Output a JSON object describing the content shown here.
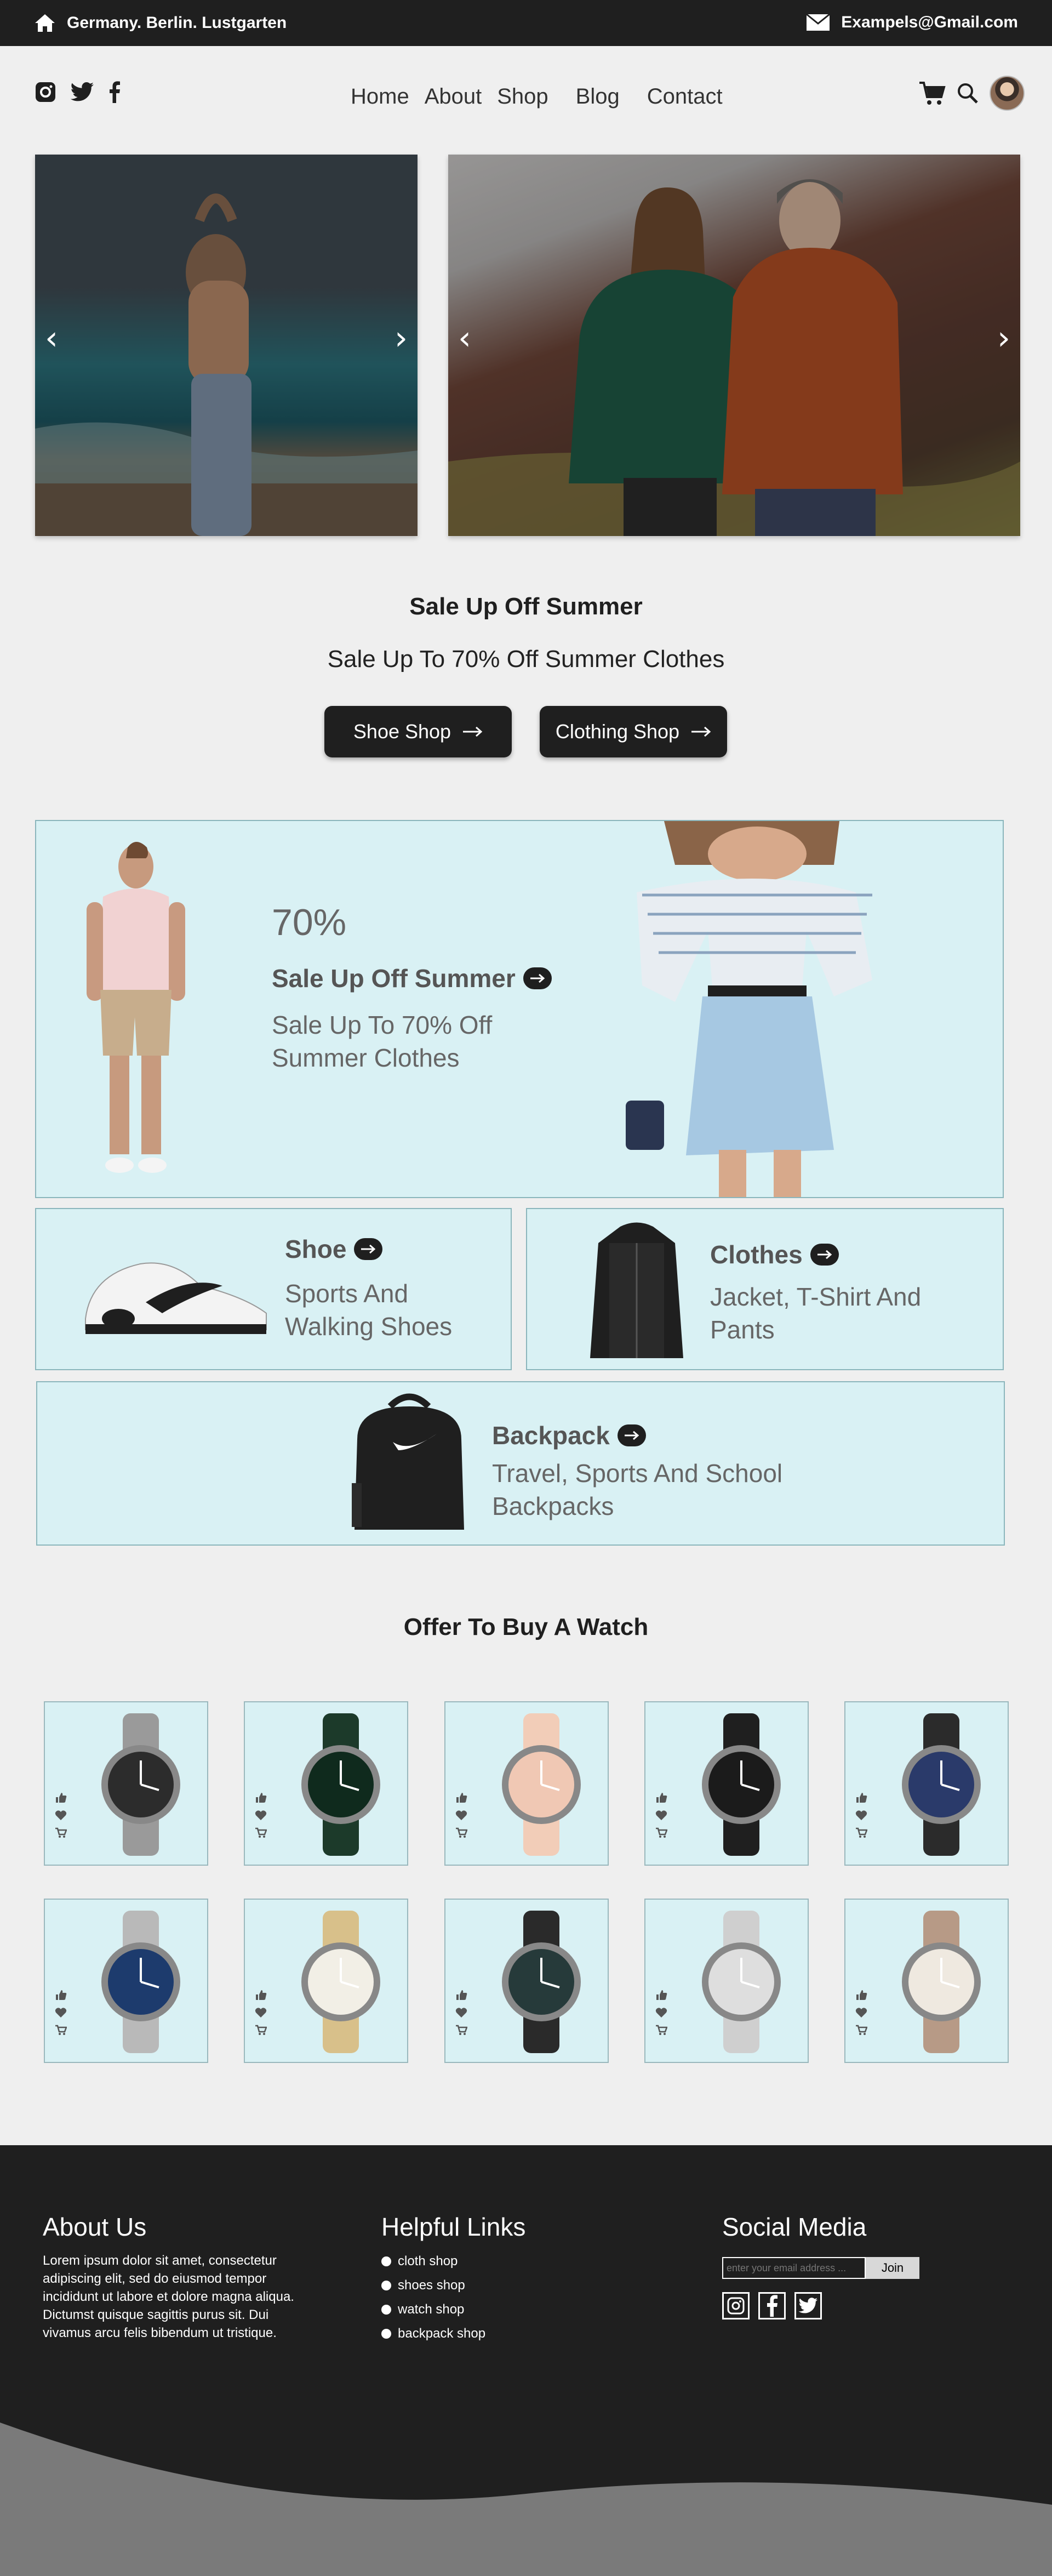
{
  "topbar": {
    "location": "Germany. Berlin. Lustgarten",
    "email": "Exampels@Gmail.com"
  },
  "nav": {
    "items": [
      "Home",
      "About",
      "Shop",
      "Blog",
      "Contact"
    ]
  },
  "hero": {
    "title": "Sale Up Off Summer",
    "subtitle": "Sale Up To 70% Off Summer Clothes",
    "btn_shoe": "Shoe Shop",
    "btn_clothing": "Clothing Shop"
  },
  "promo": {
    "percent": "70%",
    "title": "Sale Up Off Summer",
    "desc_line1": "Sale Up To 70% Off",
    "desc_line2": "Summer Clothes"
  },
  "shoe": {
    "title": "Shoe",
    "desc_line1": "Sports And",
    "desc_line2": "Walking Shoes"
  },
  "clothes": {
    "title": "Clothes",
    "desc_line1": "Jacket, T-Shirt And",
    "desc_line2": "Pants"
  },
  "backpack": {
    "title": "Backpack",
    "desc_line1": "Travel, Sports And School",
    "desc_line2": "Backpacks"
  },
  "watch_section": {
    "title": "Offer To Buy A Watch"
  },
  "footer": {
    "about_title": "About Us",
    "about_text": "Lorem ipsum dolor sit amet, consectetur adipiscing elit, sed do eiusmod tempor incididunt ut labore et dolore magna aliqua. Dictumst quisque sagittis purus sit. Dui vivamus arcu felis bibendum ut tristique.",
    "links_title": "Helpful Links",
    "links": [
      "cloth shop",
      "shoes shop",
      "watch shop",
      "backpack shop"
    ],
    "social_title": "Social Media",
    "email_placeholder": "enter your email address ...",
    "join": "Join"
  },
  "colors": {
    "dark": "#1f1f1f",
    "card_bg": "#d9f1f4",
    "page_bg": "#efefef"
  }
}
